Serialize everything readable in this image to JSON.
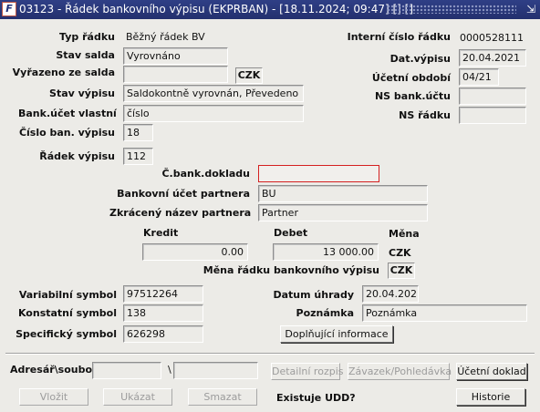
{
  "window": {
    "title": "03123 - Řádek bankovního výpisu (EKPRBAN) - [18.11.2024; 09:47] [] []",
    "app_icon_text": "F",
    "minimize_glyph": "⇲"
  },
  "fields": {
    "typ_radku": {
      "label": "Typ řádku",
      "value": "Běžný řádek BV"
    },
    "stav_salda": {
      "label": "Stav salda",
      "value": "Vyrovnáno"
    },
    "vyrazeno_ze_salda": {
      "label": "Vyřazeno ze salda",
      "value": "",
      "currency": "CZK"
    },
    "stav_vypisu": {
      "label": "Stav výpisu",
      "value": "Saldokontně vyrovnán, Převedeno"
    },
    "bank_ucet_vlastni": {
      "label": "Bank.účet vlastní",
      "value": "číslo"
    },
    "cislo_ban_vypisu": {
      "label": "Číslo ban. výpisu",
      "value": "18"
    },
    "radek_vypisu": {
      "label": "Řádek výpisu",
      "value": "112"
    },
    "interni_cislo_radku": {
      "label": "Interní číslo řádku",
      "value": "0000528111"
    },
    "dat_vypisu": {
      "label": "Dat.výpisu",
      "value": "20.04.2021"
    },
    "ucetni_obdobi": {
      "label": "Účetní období",
      "value": "04/21"
    },
    "ns_bank_uctu": {
      "label": "NS bank.účtu",
      "value": ""
    },
    "ns_radku": {
      "label": "NS řádku",
      "value": ""
    },
    "c_bank_dokladu": {
      "label": "Č.bank.dokladu",
      "value": ""
    },
    "bankovni_ucet_partnera": {
      "label": "Bankovní účet partnera",
      "value": "BU"
    },
    "zkraceny_nazev_partnera": {
      "label": "Zkrácený název partnera",
      "value": "Partner"
    },
    "kredit": {
      "label": "Kredit",
      "value": "0.00"
    },
    "debet": {
      "label": "Debet",
      "value": "13 000.00"
    },
    "mena": {
      "label": "Měna",
      "value": "CZK"
    },
    "mena_radku": {
      "label": "Měna řádku bankovního výpisu",
      "value": "CZK"
    },
    "variabilni_symbol": {
      "label": "Variabilní symbol",
      "value": "97512264"
    },
    "konstantni_symbol": {
      "label": "Konstatní symbol",
      "value": "138"
    },
    "specificky_symbol": {
      "label": "Specifický symbol",
      "value": "626298"
    },
    "datum_uhrady": {
      "label": "Datum úhrady",
      "value": "20.04.2021"
    },
    "poznamka": {
      "label": "Poznámka",
      "value": "Poznámka"
    }
  },
  "buttons": {
    "doplnujici": "Doplňující informace",
    "detailni_rozpis": "Detailní rozpis",
    "zavazek": "Závazek/Pohledávka",
    "ucetni_doklad": "Účetní doklad",
    "vlozit": "Vložit",
    "ukazat": "Ukázat",
    "smazat": "Smazat",
    "historie": "Historie"
  },
  "bottom": {
    "adresar_label": "Adresář\\soubor",
    "adresar_value": "",
    "path_separator": "\\",
    "soubor_value": "",
    "existuje_udd": "Existuje UDD?"
  },
  "colors": {
    "titlebar": "#23306e",
    "background": "#ecebe7",
    "error_border": "#d42020"
  }
}
